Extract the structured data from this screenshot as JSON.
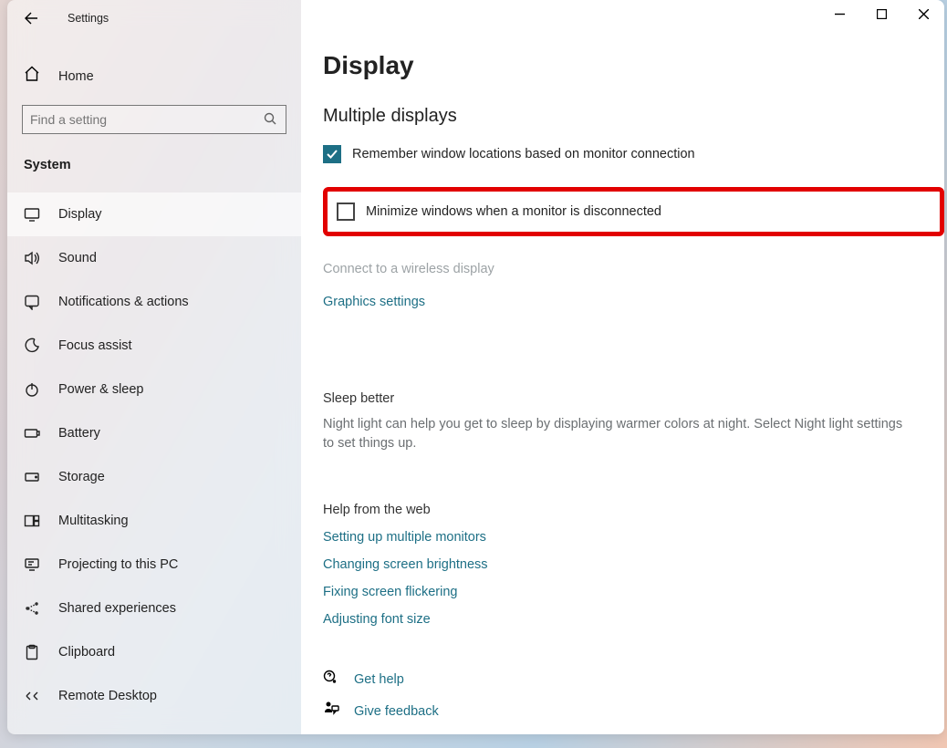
{
  "app": {
    "title": "Settings"
  },
  "sidebar": {
    "home": "Home",
    "search_placeholder": "Find a setting",
    "category": "System",
    "items": [
      {
        "label": "Display"
      },
      {
        "label": "Sound"
      },
      {
        "label": "Notifications & actions"
      },
      {
        "label": "Focus assist"
      },
      {
        "label": "Power & sleep"
      },
      {
        "label": "Battery"
      },
      {
        "label": "Storage"
      },
      {
        "label": "Multitasking"
      },
      {
        "label": "Projecting to this PC"
      },
      {
        "label": "Shared experiences"
      },
      {
        "label": "Clipboard"
      },
      {
        "label": "Remote Desktop"
      }
    ]
  },
  "main": {
    "title": "Display",
    "multiple_displays": {
      "heading": "Multiple displays",
      "remember_label": "Remember window locations based on monitor connection",
      "remember_checked": true,
      "minimize_label": "Minimize windows when a monitor is disconnected",
      "minimize_checked": false,
      "connect_wireless": "Connect to a wireless display",
      "graphics_settings": "Graphics settings"
    },
    "sleep": {
      "heading": "Sleep better",
      "text": "Night light can help you get to sleep by displaying warmer colors at night. Select Night light settings to set things up."
    },
    "help": {
      "heading": "Help from the web",
      "links": [
        "Setting up multiple monitors",
        "Changing screen brightness",
        "Fixing screen flickering",
        "Adjusting font size"
      ]
    },
    "footer": {
      "get_help": "Get help",
      "give_feedback": "Give feedback"
    }
  }
}
